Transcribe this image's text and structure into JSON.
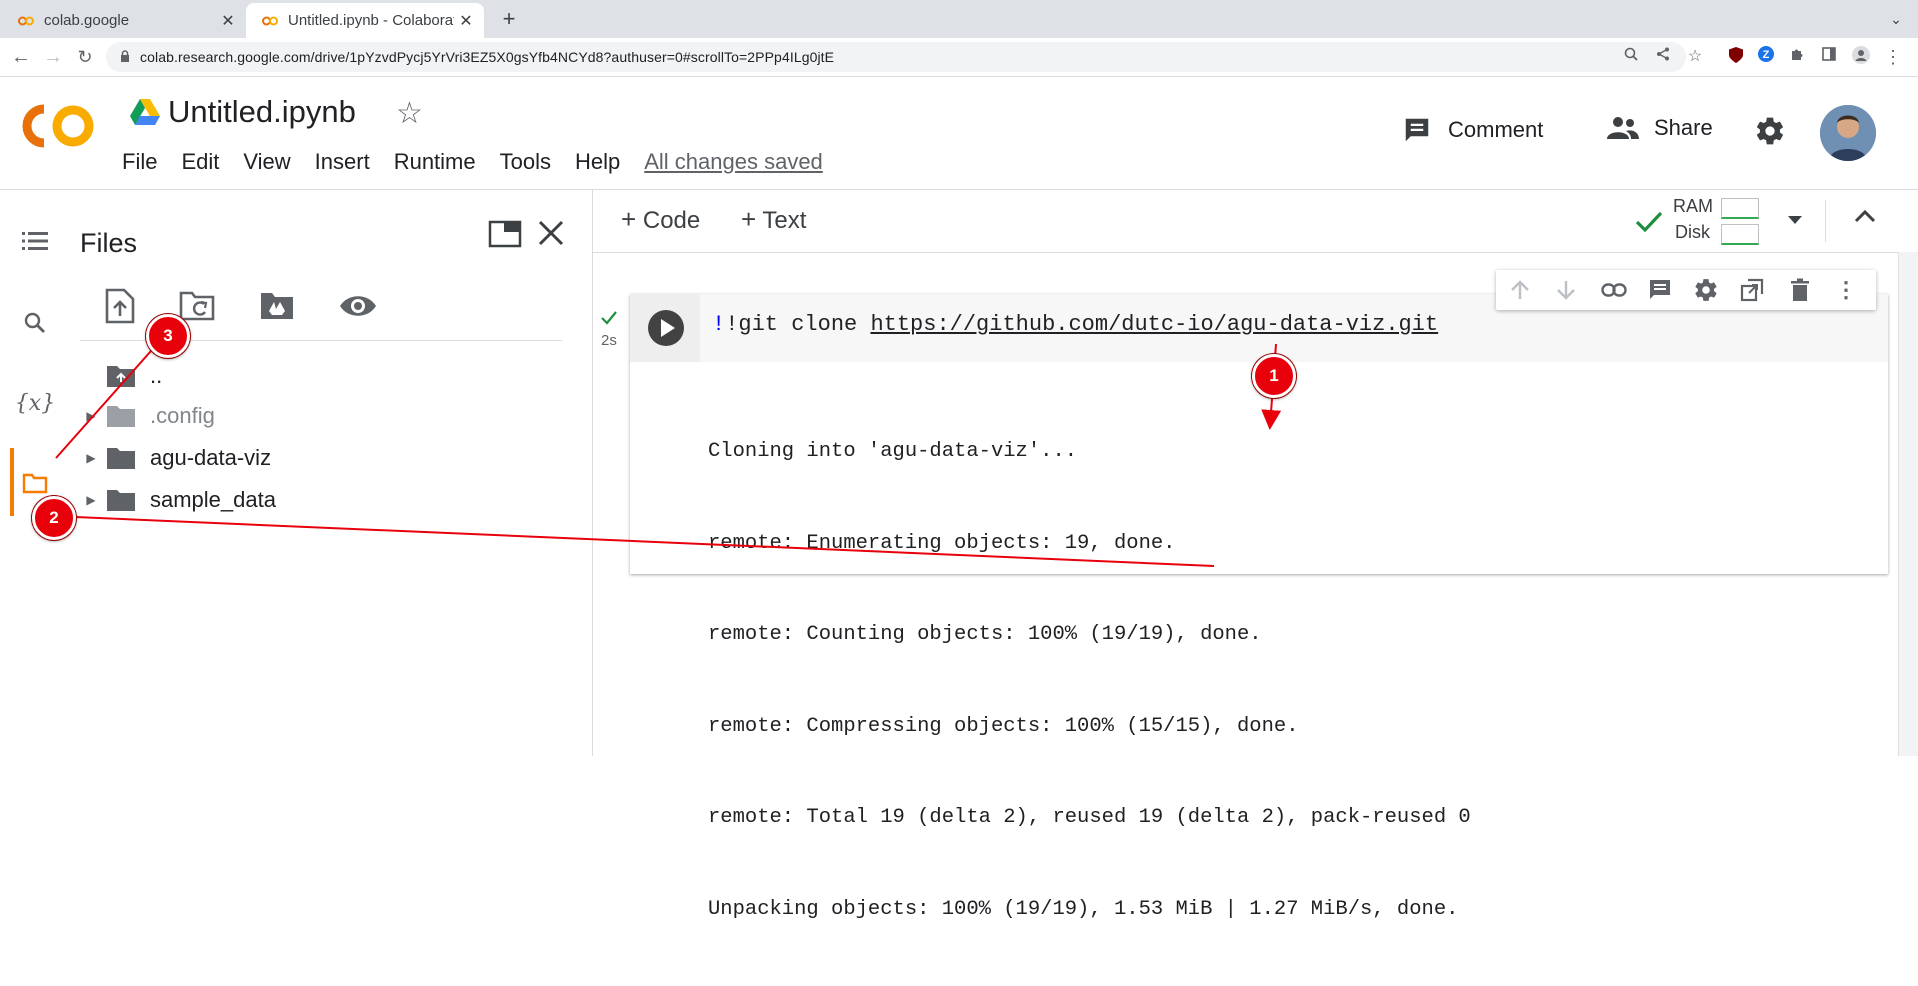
{
  "browser": {
    "tabs": [
      {
        "title": "colab.google",
        "active": false
      },
      {
        "title": "Untitled.ipynb - Colaborat",
        "active": true
      }
    ],
    "url": "colab.research.google.com/drive/1pYzvdPycj5YrVri3EZ5X0gsYfb4NCYd8?authuser=0#scrollTo=2PPp4ILg0jtE"
  },
  "header": {
    "title": "Untitled.ipynb",
    "menu": [
      "File",
      "Edit",
      "View",
      "Insert",
      "Runtime",
      "Tools",
      "Help"
    ],
    "save_status": "All changes saved",
    "comment_label": "Comment",
    "share_label": "Share"
  },
  "files_panel": {
    "title": "Files",
    "items": [
      {
        "name": "..",
        "expandable": false,
        "kind": "parent"
      },
      {
        "name": ".config",
        "expandable": true,
        "kind": "hidden-folder"
      },
      {
        "name": "agu-data-viz",
        "expandable": true,
        "kind": "folder"
      },
      {
        "name": "sample_data",
        "expandable": true,
        "kind": "folder"
      }
    ]
  },
  "notebook_toolbar": {
    "add_code_label": "Code",
    "add_text_label": "Text",
    "ram_label": "RAM",
    "disk_label": "Disk"
  },
  "cell": {
    "exec_time": "2s",
    "code_prefix": "!git clone ",
    "code_url": "https://github.com/dutc-io/agu-data-viz.git",
    "output": [
      "Cloning into 'agu-data-viz'...",
      "remote: Enumerating objects: 19, done.",
      "remote: Counting objects: 100% (19/19), done.",
      "remote: Compressing objects: 100% (15/15), done.",
      "remote: Total 19 (delta 2), reused 19 (delta 2), pack-reused 0",
      "Unpacking objects: 100% (19/19), 1.53 MiB | 1.27 MiB/s, done."
    ]
  },
  "annotations": {
    "badges": [
      "1",
      "2",
      "3"
    ],
    "color": "#e8000b"
  },
  "colors": {
    "colab_orange": "#f9ab00",
    "colab_dark_orange": "#e8710a",
    "accent_active": "#f57c00",
    "check_green": "#1e8e3e"
  }
}
